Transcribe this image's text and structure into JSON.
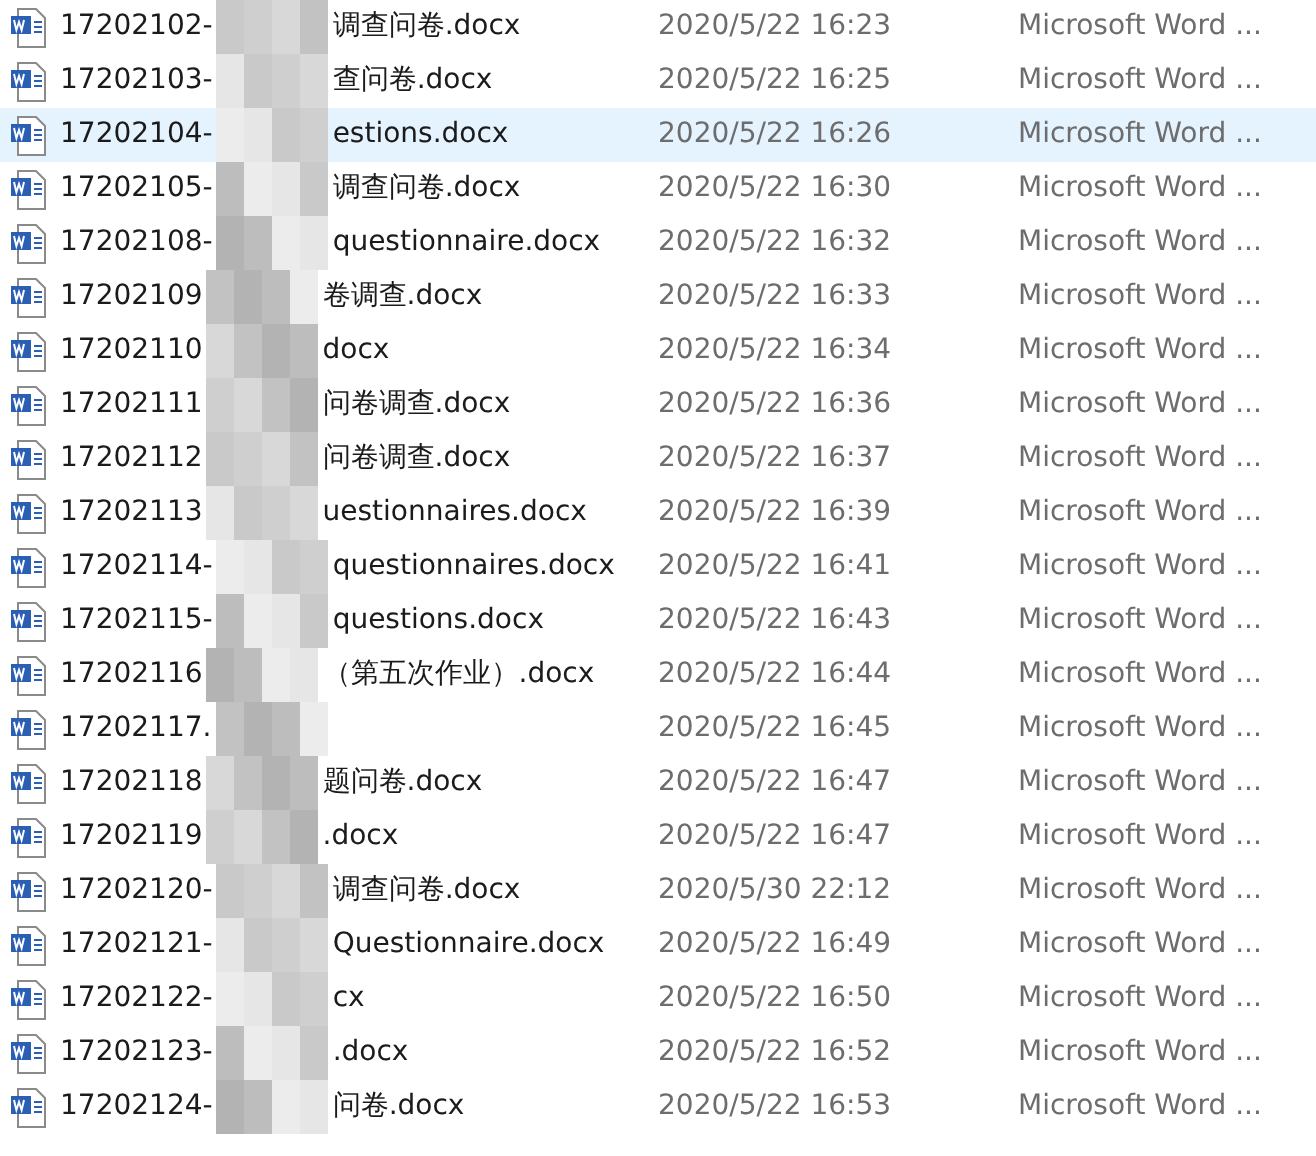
{
  "files": [
    {
      "name_start": "17202102-",
      "name_end": "调查问卷.docx",
      "modified": "2020/5/22 16:23",
      "type": "Microsoft Word ...",
      "selected": false
    },
    {
      "name_start": "17202103-",
      "name_end": "查问卷.docx",
      "modified": "2020/5/22 16:25",
      "type": "Microsoft Word ...",
      "selected": false
    },
    {
      "name_start": "17202104-",
      "name_end": "estions.docx",
      "modified": "2020/5/22 16:26",
      "type": "Microsoft Word ...",
      "selected": true
    },
    {
      "name_start": "17202105-",
      "name_end": "调查问卷.docx",
      "modified": "2020/5/22 16:30",
      "type": "Microsoft Word ...",
      "selected": false
    },
    {
      "name_start": "17202108-",
      "name_end": "questionnaire.docx",
      "modified": "2020/5/22 16:32",
      "type": "Microsoft Word ...",
      "selected": false
    },
    {
      "name_start": "17202109",
      "name_end": "卷调查.docx",
      "modified": "2020/5/22 16:33",
      "type": "Microsoft Word ...",
      "selected": false
    },
    {
      "name_start": "17202110",
      "name_end": "docx",
      "modified": "2020/5/22 16:34",
      "type": "Microsoft Word ...",
      "selected": false
    },
    {
      "name_start": "17202111",
      "name_end": "问卷调查.docx",
      "modified": "2020/5/22 16:36",
      "type": "Microsoft Word ...",
      "selected": false
    },
    {
      "name_start": "17202112",
      "name_end": "问卷调查.docx",
      "modified": "2020/5/22 16:37",
      "type": "Microsoft Word ...",
      "selected": false
    },
    {
      "name_start": "17202113",
      "name_end": "uestionnaires.docx",
      "modified": "2020/5/22 16:39",
      "type": "Microsoft Word ...",
      "selected": false
    },
    {
      "name_start": "17202114-",
      "name_end": "questionnaires.docx",
      "modified": "2020/5/22 16:41",
      "type": "Microsoft Word ...",
      "selected": false
    },
    {
      "name_start": "17202115-",
      "name_end": "questions.docx",
      "modified": "2020/5/22 16:43",
      "type": "Microsoft Word ...",
      "selected": false
    },
    {
      "name_start": "17202116",
      "name_end": "（第五次作业）.docx",
      "modified": "2020/5/22 16:44",
      "type": "Microsoft Word ...",
      "selected": false
    },
    {
      "name_start": "17202117.",
      "modified": "2020/5/22 16:45",
      "type": "Microsoft Word ...",
      "selected": false
    },
    {
      "name_start": "17202118",
      "name_end": "题问卷.docx",
      "modified": "2020/5/22 16:47",
      "type": "Microsoft Word ...",
      "selected": false
    },
    {
      "name_start": "17202119",
      "name_end": ".docx",
      "modified": "2020/5/22 16:47",
      "type": "Microsoft Word ...",
      "selected": false
    },
    {
      "name_start": "17202120-",
      "name_end": "调查问卷.docx",
      "modified": "2020/5/30 22:12",
      "type": "Microsoft Word ...",
      "selected": false
    },
    {
      "name_start": "17202121-",
      "name_end": "Questionnaire.docx",
      "modified": "2020/5/22 16:49",
      "type": "Microsoft Word ...",
      "selected": false
    },
    {
      "name_start": "17202122-",
      "name_end": "cx",
      "modified": "2020/5/22 16:50",
      "type": "Microsoft Word ...",
      "selected": false
    },
    {
      "name_start": "17202123-",
      "name_end": ".docx",
      "modified": "2020/5/22 16:52",
      "type": "Microsoft Word ...",
      "selected": false
    },
    {
      "name_start": "17202124-",
      "name_end": "问卷.docx",
      "modified": "2020/5/22 16:53",
      "type": "Microsoft Word ...",
      "selected": false
    }
  ]
}
